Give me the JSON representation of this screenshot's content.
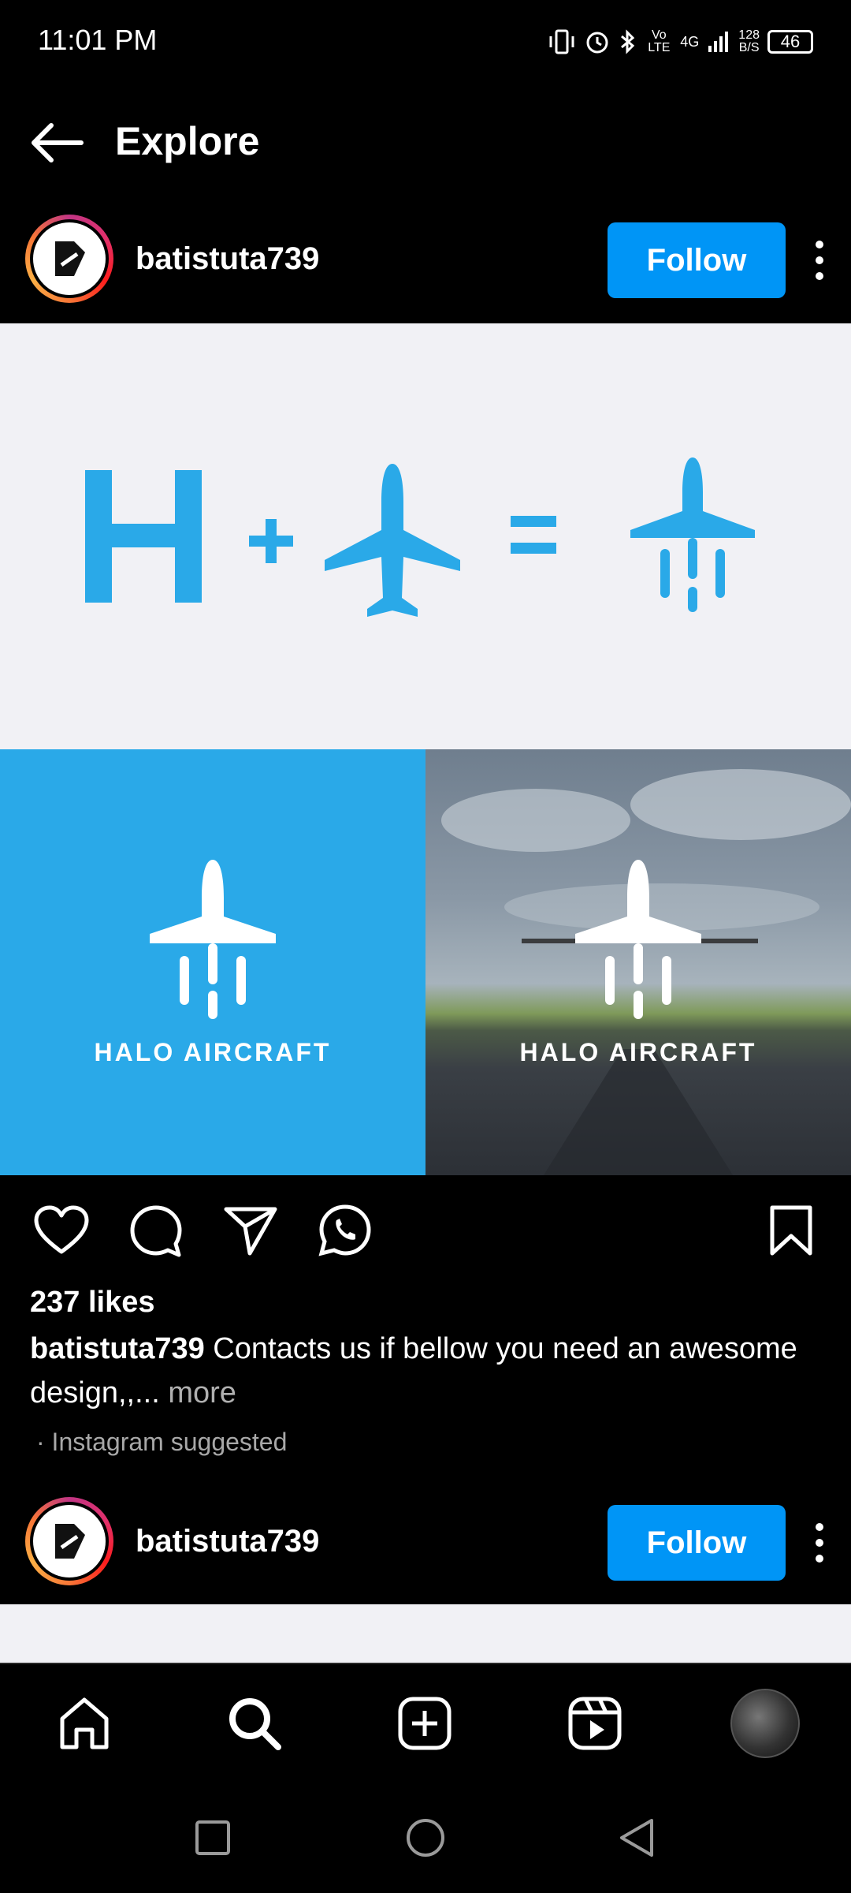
{
  "status_bar": {
    "time": "11:01 PM",
    "network": "4G",
    "volte": "Vo LTE",
    "speed_value": "128",
    "speed_unit": "B/S",
    "battery": "46"
  },
  "header": {
    "title": "Explore"
  },
  "post": {
    "username": "batistuta739",
    "follow_label": "Follow",
    "image_labels": [
      "HALO AIRCRAFT",
      "HALO AIRCRAFT"
    ],
    "likes": "237 likes",
    "caption_user": "batistuta739",
    "caption_text": " Contacts us if bellow you need an awesome design,,... ",
    "caption_more": "more",
    "suggested": "· Instagram suggested"
  },
  "next_post": {
    "username": "batistuta739",
    "follow_label": "Follow"
  },
  "icons": {
    "back": "arrow-left-icon",
    "like": "heart-icon",
    "comment": "comment-icon",
    "share": "send-icon",
    "whatsapp": "whatsapp-icon",
    "save": "bookmark-icon",
    "home": "home-icon",
    "search": "search-icon",
    "create": "plus-square-icon",
    "reels": "reels-icon"
  },
  "colors": {
    "accent": "#0095f6",
    "logo_blue": "#2aa9e8"
  }
}
